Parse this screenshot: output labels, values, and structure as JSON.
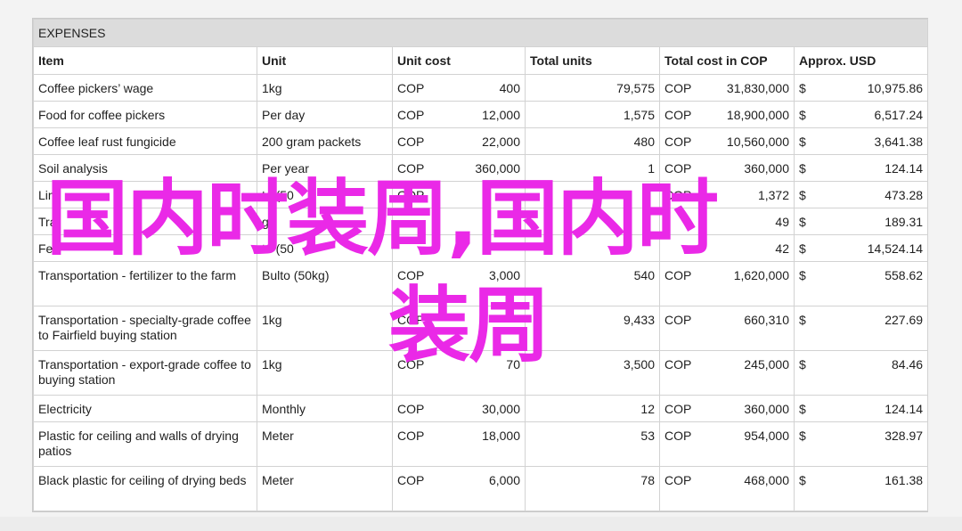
{
  "table": {
    "title": "EXPENSES",
    "headers": [
      "Item",
      "Unit",
      "Unit cost",
      "Total units",
      "Total cost in COP",
      "Approx. USD"
    ],
    "rows": [
      {
        "item": "Coffee pickers’ wage",
        "unit": "1kg",
        "cur": "COP",
        "unit_cost": "400",
        "total_units": "79,575",
        "cur2": "COP",
        "total_cost": "31,830,000",
        "usd_sign": "$",
        "usd": "10,975.86"
      },
      {
        "item": "Food for coffee pickers",
        "unit": "Per day",
        "cur": "COP",
        "unit_cost": "12,000",
        "total_units": "1,575",
        "cur2": "COP",
        "total_cost": "18,900,000",
        "usd_sign": "$",
        "usd": "6,517.24"
      },
      {
        "item": "Coffee leaf rust fungicide",
        "unit": "200 gram packets",
        "cur": "COP",
        "unit_cost": "22,000",
        "total_units": "480",
        "cur2": "COP",
        "total_cost": "10,560,000",
        "usd_sign": "$",
        "usd": "3,641.38"
      },
      {
        "item": "Soil analysis",
        "unit": "Per year",
        "cur": "COP",
        "unit_cost": "360,000",
        "total_units": "1",
        "cur2": "COP",
        "total_cost": "360,000",
        "usd_sign": "$",
        "usd": "124.14"
      },
      {
        "item": "Lim",
        "unit": "to (50",
        "cur": "COP",
        "unit_cost": "",
        "total_units": "",
        "cur2": "COP",
        "total_cost": "1,372",
        "usd_sign": "$",
        "usd": "473.28"
      },
      {
        "item": "Tra",
        "unit": "g)",
        "cur": "",
        "unit_cost": "",
        "total_units": "",
        "cur2": "",
        "total_cost": "49",
        "usd_sign": "$",
        "usd": "189.31"
      },
      {
        "item": "Fe",
        "unit": "to (50",
        "cur": "",
        "unit_cost": "",
        "total_units": "",
        "cur2": "",
        "total_cost": "42",
        "usd_sign": "$",
        "usd": "14,524.14"
      },
      {
        "item": "Transportation - fertilizer to the farm",
        "unit": "Bulto (50kg)",
        "cur": "COP",
        "unit_cost": "3,000",
        "total_units": "540",
        "cur2": "COP",
        "total_cost": "1,620,000",
        "usd_sign": "$",
        "usd": "558.62"
      },
      {
        "item": "Transportation - specialty-grade coffee to Fairfield buying station",
        "unit": "1kg",
        "cur": "COP",
        "unit_cost": "",
        "total_units": "9,433",
        "cur2": "COP",
        "total_cost": "660,310",
        "usd_sign": "$",
        "usd": "227.69"
      },
      {
        "item": "Transportation - export-grade coffee to buying station",
        "unit": "1kg",
        "cur": "COP",
        "unit_cost": "70",
        "total_units": "3,500",
        "cur2": "COP",
        "total_cost": "245,000",
        "usd_sign": "$",
        "usd": "84.46"
      },
      {
        "item": "Electricity",
        "unit": "Monthly",
        "cur": "COP",
        "unit_cost": "30,000",
        "total_units": "12",
        "cur2": "COP",
        "total_cost": "360,000",
        "usd_sign": "$",
        "usd": "124.14"
      },
      {
        "item": "Plastic for ceiling and walls of drying patios",
        "unit": "Meter",
        "cur": "COP",
        "unit_cost": "18,000",
        "total_units": "53",
        "cur2": "COP",
        "total_cost": "954,000",
        "usd_sign": "$",
        "usd": "328.97"
      },
      {
        "item": "Black plastic for ceiling of drying beds",
        "unit": "Meter",
        "cur": "COP",
        "unit_cost": "6,000",
        "total_units": "78",
        "cur2": "COP",
        "total_cost": "468,000",
        "usd_sign": "$",
        "usd": "161.38"
      }
    ]
  },
  "watermark": {
    "line1": "国内时装周,国内时",
    "line2": "装周",
    "color": "#ea29e7"
  }
}
